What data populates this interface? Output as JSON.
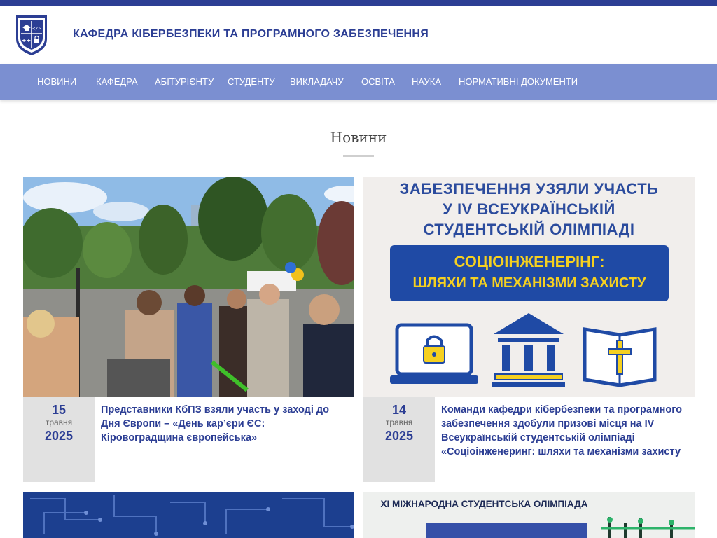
{
  "header": {
    "title": "КАФЕДРА КІБЕРБЕЗПЕКИ ТА ПРОГРАМНОГО ЗАБЕЗПЕЧЕННЯ",
    "logo_icon": "shield-logo-icon",
    "logo_glyphs": [
      "</>",
      "++"
    ],
    "colors": {
      "brand": "#2c3e94",
      "nav": "#7b8fd1",
      "date_bg": "#e1e1e1"
    }
  },
  "nav": {
    "items": [
      "НОВИНИ",
      "КАФЕДРА",
      "АБІТУРІЄНТУ",
      "СТУДЕНТУ",
      "ВИКЛАДАЧУ",
      "ОСВІТА",
      "НАУКА",
      "НОРМАТИВНІ ДОКУМЕНТИ"
    ]
  },
  "main": {
    "section_title": "Новини",
    "cards": [
      {
        "day": "15",
        "month": "травня",
        "year": "2025",
        "title": "Представники КбПЗ взяли участь у заході до Дня Європи – «День кар’єри ЄС: Кіровоградщина європейська»",
        "image_icon": "outdoor-event-photo"
      },
      {
        "day": "14",
        "month": "травня",
        "year": "2025",
        "title": "Команди кафедри кібербезпеки та програмного забезпечення здобули призові місця на IV Всеукраїнській студентській олімпіаді «Соціоінженеринг: шляхи та механізми захисту",
        "image_lines": [
          "ЗАБЕЗПЕЧЕННЯ УЗЯЛИ УЧАСТЬ",
          "У IV ВСЕУКРАЇНСЬКІЙ",
          "СТУДЕНТСЬКІЙ ОЛІМПІАДІ"
        ],
        "image_box_lines": [
          "СОЦІОІНЖЕНЕРІНГ:",
          "ШЛЯХИ ТА МЕХАНІЗМИ ЗАХИСТУ"
        ],
        "image_icons": [
          "laptop-lock-icon",
          "institution-icon",
          "book-cross-icon"
        ]
      }
    ],
    "partial_cards": [
      {
        "image_icon": "circuit-pattern-image"
      },
      {
        "banner_text": "XI МІЖНАРОДНА СТУДЕНТСЬКА ОЛІМПІАДА"
      }
    ]
  }
}
